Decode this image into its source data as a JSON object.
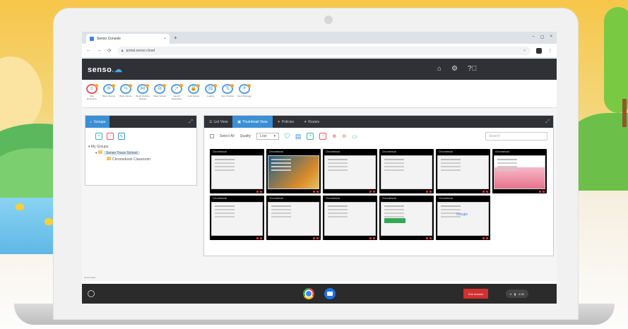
{
  "browser": {
    "tab_title": "Senso Console",
    "tab_close": "×",
    "new_tab": "+",
    "url": "portal.senso.cloud",
    "window_controls": [
      "–",
      "▢",
      "×"
    ]
  },
  "app": {
    "brand": "senso",
    "brand_mark": ".☁",
    "header_icons": [
      "home-icon",
      "gear-icon",
      "help-icon"
    ]
  },
  "toolbar": [
    {
      "label": "Stop Restriction",
      "icon": "⦸"
    },
    {
      "label": "Block Internet",
      "icon": "⊕"
    },
    {
      "label": "Block Device",
      "icon": "⇆"
    },
    {
      "label": "Block Website Storage",
      "icon": "⋈"
    },
    {
      "label": "Share Screen",
      "icon": "⧉"
    },
    {
      "label": "Launch Application",
      "icon": "➚"
    },
    {
      "label": "Lock Screen",
      "icon": "🔒"
    },
    {
      "label": "Logging",
      "icon": "▤"
    },
    {
      "label": "Sync Policies",
      "icon": "⇅"
    },
    {
      "label": "Send Message",
      "icon": "✈"
    }
  ],
  "groups_panel": {
    "tab_label": "Groups",
    "tree": {
      "root": "My Groups",
      "school": "Senso Trace School",
      "class": "Chromebook Classroom"
    }
  },
  "thumb_panel": {
    "tabs": [
      "List View",
      "Thumbnail View",
      "Policies",
      "Routes"
    ],
    "select_all": "Select All",
    "quality_label": "Quality",
    "quality_value": "Low",
    "search_placeholder": "Search",
    "thumbnails": [
      {
        "label": "Chromebook",
        "style": "doc"
      },
      {
        "label": "Chromebook",
        "style": "wall"
      },
      {
        "label": "Chromebook",
        "style": "doc"
      },
      {
        "label": "Chromebook",
        "style": "doc"
      },
      {
        "label": "Chromebook",
        "style": "doc"
      },
      {
        "label": "Chromebook",
        "style": "pink"
      },
      {
        "label": "Chromebook",
        "style": "doc"
      },
      {
        "label": "Chromebook",
        "style": "doc"
      },
      {
        "label": "Chromebook",
        "style": "doc"
      },
      {
        "label": "Chromebook",
        "style": "green"
      },
      {
        "label": "Chromebook",
        "style": "gg"
      }
    ]
  },
  "version_text": "senso.cloud",
  "shelf": {
    "exit_label": "Exit session",
    "clock": "4:30"
  }
}
